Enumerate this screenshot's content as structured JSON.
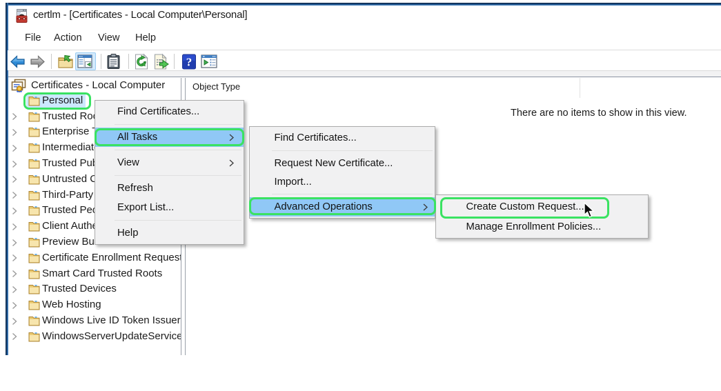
{
  "titlebar": {
    "title": "certlm - [Certificates - Local Computer\\Personal]",
    "app_icon": "mmc-console-icon"
  },
  "menubar": {
    "items": [
      {
        "label": "File"
      },
      {
        "label": "Action"
      },
      {
        "label": "View"
      },
      {
        "label": "Help"
      }
    ]
  },
  "toolbar": {
    "buttons": [
      {
        "name": "back",
        "icon": "back-arrow-icon",
        "enabled": true
      },
      {
        "name": "forward",
        "icon": "forward-arrow-icon",
        "enabled": false
      },
      {
        "name": "up-one-level",
        "icon": "folder-up-icon",
        "enabled": true
      },
      {
        "name": "show-console-tree",
        "icon": "console-tree-icon",
        "active": true
      },
      {
        "name": "properties",
        "icon": "clipboard-icon",
        "enabled": true
      },
      {
        "name": "refresh",
        "icon": "refresh-icon",
        "enabled": true
      },
      {
        "name": "export-list",
        "icon": "export-list-icon",
        "enabled": true
      },
      {
        "name": "help",
        "icon": "help-icon",
        "enabled": true
      },
      {
        "name": "show-action-pane",
        "icon": "console-window-icon",
        "enabled": true
      }
    ]
  },
  "tree": {
    "root_label": "Certificates - Local Computer",
    "items": [
      {
        "label": "Personal",
        "selected": true,
        "expandable": false,
        "annotated": true
      },
      {
        "label": "Trusted Root Certification Authorities",
        "expandable": true
      },
      {
        "label": "Enterprise Trust",
        "expandable": true
      },
      {
        "label": "Intermediate Certification Authorities",
        "expandable": true
      },
      {
        "label": "Trusted Publishers",
        "expandable": true
      },
      {
        "label": "Untrusted Certificates",
        "expandable": true
      },
      {
        "label": "Third-Party Root Certification Authorities",
        "expandable": true
      },
      {
        "label": "Trusted People",
        "expandable": true
      },
      {
        "label": "Client Authentication Issuers",
        "expandable": true
      },
      {
        "label": "Preview Build Roots",
        "expandable": true
      },
      {
        "label": "Certificate Enrollment Requests",
        "expandable": true
      },
      {
        "label": "Smart Card Trusted Roots",
        "expandable": true
      },
      {
        "label": "Trusted Devices",
        "expandable": true
      },
      {
        "label": "Web Hosting",
        "expandable": true
      },
      {
        "label": "Windows Live ID Token Issuer",
        "expandable": true
      },
      {
        "label": "WindowsServerUpdateServices",
        "expandable": true
      }
    ]
  },
  "list_view": {
    "column_header": "Object Type",
    "empty_message": "There are no items to show in this view."
  },
  "context_menu": {
    "items": [
      {
        "type": "item",
        "label": "Find Certificates..."
      },
      {
        "type": "separator"
      },
      {
        "type": "item",
        "label": "All Tasks",
        "submenu": true,
        "highlighted": true,
        "annotated": true
      },
      {
        "type": "separator"
      },
      {
        "type": "item",
        "label": "View",
        "submenu": true
      },
      {
        "type": "separator"
      },
      {
        "type": "item",
        "label": "Refresh"
      },
      {
        "type": "item",
        "label": "Export List..."
      },
      {
        "type": "separator"
      },
      {
        "type": "item",
        "label": "Help"
      }
    ]
  },
  "all_tasks_submenu": {
    "items": [
      {
        "type": "item",
        "label": "Find Certificates..."
      },
      {
        "type": "separator"
      },
      {
        "type": "item",
        "label": "Request New Certificate..."
      },
      {
        "type": "item",
        "label": "Import...",
        "compact": true
      },
      {
        "type": "separator"
      },
      {
        "type": "item",
        "label": "Advanced Operations",
        "submenu": true,
        "highlighted": true,
        "annotated": true
      }
    ]
  },
  "advanced_operations_submenu": {
    "items": [
      {
        "type": "item",
        "label": "Create Custom Request...",
        "annotated": true,
        "cursor": true
      },
      {
        "type": "item",
        "label": "Manage Enrollment Policies..."
      }
    ]
  },
  "colors": {
    "annotation_green": "#3ae262",
    "menu_highlight_blue": "#90c8f6",
    "tree_selection_blue": "#cce8ff",
    "window_border_blue": "#2a66a5",
    "menu_background": "#f1f1f2"
  }
}
